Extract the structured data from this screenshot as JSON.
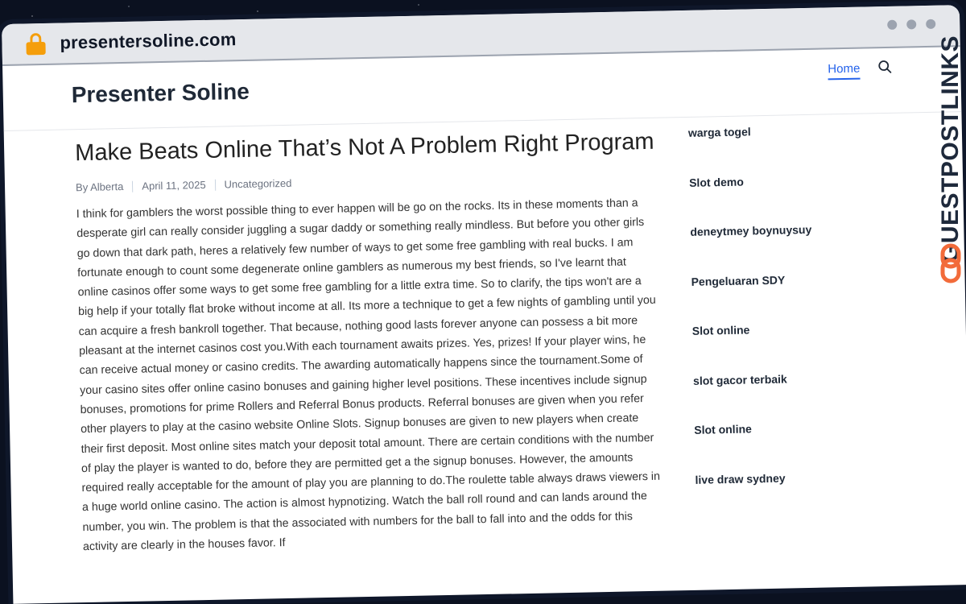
{
  "browser": {
    "url": "presentersoline.com",
    "lock_icon": "lock-icon"
  },
  "site": {
    "title": "Presenter Soline",
    "nav": {
      "home": "Home"
    }
  },
  "post": {
    "title": "Make Beats Online That’s Not A Problem Right Program",
    "author": "By Alberta",
    "date": "April 11, 2025",
    "category": "Uncategorized",
    "body": "I think for gamblers the worst possible thing to ever happen will be go on the rocks. Its in these moments than a desperate girl can really consider juggling a sugar daddy or something really mindless. But before you other girls go down that dark path, heres a relatively few number of ways to get some free gambling with real bucks. I am fortunate enough to count some degenerate online gamblers as numerous my best friends, so I've learnt that online casinos offer some ways to get some free gambling for a little extra time. So to clarify, the tips won't are a big help if your totally flat broke without income at all. Its more a technique to get a few nights of gambling until you can acquire a fresh bankroll together. That because, nothing good lasts forever anyone can possess a bit more pleasant at the internet casinos cost you.With each tournament awaits prizes. Yes, prizes! If your player wins, he can receive actual money or casino credits. The awarding automatically happens since the tournament.Some of your casino sites offer online casino bonuses and gaining higher level positions. These incentives include signup bonuses, promotions for prime Rollers and Referral Bonus products. Referral bonuses are given when you refer other players to play at the casino website Online Slots. Signup bonuses are given to new players when create their first deposit. Most online sites match your deposit total amount. There are certain conditions with the number of play the player is wanted to do, before they are permitted get a the signup bonuses. However, the amounts required really acceptable for the amount of play you are planning to do.The roulette table always draws viewers in a huge world online casino. The action is almost hypnotizing. Watch the ball roll round and can lands around the number, you win. The problem is that the associated with numbers for the ball to fall into and the odds for this activity are clearly in the houses favor. If"
  },
  "sidebar": {
    "links": [
      "warga togel",
      "Slot demo",
      "deneytmey boynuysuy",
      "Pengeluaran SDY",
      "Slot online",
      "slot gacor terbaik",
      "Slot online",
      "live draw sydney"
    ]
  },
  "watermark": {
    "text": "GUESTPOSTLINKS",
    "accent": "#f26b3a"
  }
}
